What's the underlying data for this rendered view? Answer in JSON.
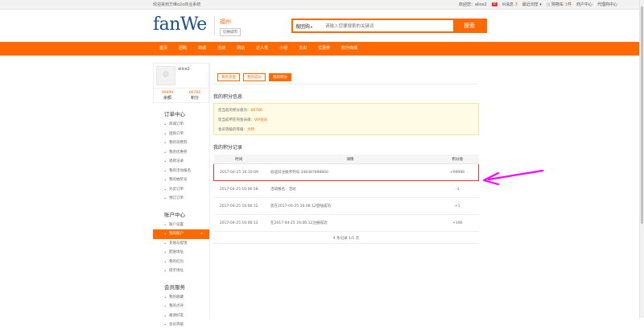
{
  "topbar": {
    "welcome": "欢迎来到方维o2o商业系统",
    "welcome_user_prefix": "欢迎您：",
    "username": "alice2",
    "message_label": "消息",
    "message_count": "3",
    "recent_label": "最近浏览",
    "cart_label": "购物车",
    "cart_count": "1",
    "cart_suffix": "件",
    "seller_center": "商户中心",
    "agent_center": "代理商中心"
  },
  "header": {
    "logo_fan": "fan",
    "logo_we": "We",
    "city_name": "福州",
    "city_switch": "切换城市",
    "search_type": "搜团购",
    "search_placeholder": "请输入您要搜索的关键词",
    "search_button": "搜索"
  },
  "nav": {
    "items": [
      "首页",
      "团购",
      "商城",
      "活动",
      "网站",
      "达人秀",
      "小组",
      "支出",
      "优惠券",
      "积分商城"
    ]
  },
  "sidebar": {
    "username": "alice2",
    "balance_value": "99999",
    "balance_label": "余额",
    "points_value": "66786",
    "points_label": "积分",
    "groups": [
      {
        "title": "订单中心",
        "items": [
          "商城订单",
          "团购订单",
          "我的消费券",
          "我的优惠券",
          "退款记录",
          "我的活动报名",
          "我的抽奖号",
          "外卖订单",
          "预订订单"
        ]
      },
      {
        "title": "账户中心",
        "items": [
          "账户设置",
          "我的账户",
          "充值与提现",
          "配送地址",
          "我的红包",
          "提示地址"
        ]
      },
      {
        "title": "会员服务",
        "items": [
          "我的收藏",
          "我的点评",
          "邀请好友",
          "会员等级"
        ]
      }
    ]
  },
  "content": {
    "tabs": [
      "我的资金",
      "我的成长",
      "我的积分"
    ],
    "info_title": "我的积分信息",
    "info_rows": [
      {
        "label": "您当前的积分值为：",
        "value": "66786"
      },
      {
        "label": "您当前所在的会员组：",
        "value": "VIP会员"
      },
      {
        "label": "会员等级的等级：",
        "value": "大师"
      }
    ],
    "records_title": "我的积分记录",
    "columns": [
      "时间",
      "详情",
      "积分值"
    ],
    "rows": [
      {
        "time": "2017-04-25 16:10:09",
        "detail": "验证码注册序列号:348387898800",
        "points": "+99999"
      },
      {
        "time": "2017-04-25 16:06:58",
        "detail": "活动报名：活动",
        "points": "-1"
      },
      {
        "time": "2017-04-25 16:06:12",
        "detail": "您在2017-04-25 16:06:12登陆成功",
        "points": "+1"
      },
      {
        "time": "2017-04-25 16:06:12",
        "detail": "在2017-04-25 16:06:12注册成功",
        "points": "+100"
      }
    ],
    "pager": "4 条记录 1/1 页"
  },
  "colors": {
    "accent": "#ff6a00",
    "highlight": "#e4393c",
    "arrow": "#ff00ff"
  }
}
